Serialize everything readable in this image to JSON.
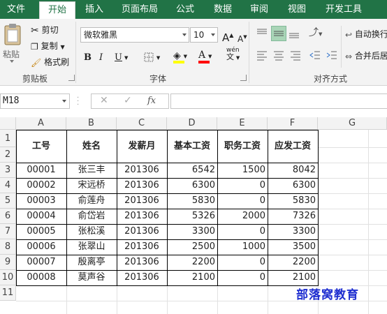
{
  "tabs": [
    {
      "id": "file",
      "label": "文件"
    },
    {
      "id": "home",
      "label": "开始"
    },
    {
      "id": "insert",
      "label": "插入"
    },
    {
      "id": "layout",
      "label": "页面布局"
    },
    {
      "id": "formulas",
      "label": "公式"
    },
    {
      "id": "data",
      "label": "数据"
    },
    {
      "id": "review",
      "label": "审阅"
    },
    {
      "id": "view",
      "label": "视图"
    },
    {
      "id": "developer",
      "label": "开发工具"
    }
  ],
  "clipboard": {
    "paste_label": "粘贴",
    "cut_label": "剪切",
    "copy_label": "复制",
    "painter_label": "格式刷",
    "group_label": "剪贴板"
  },
  "font": {
    "family": "微软雅黑",
    "size": "10",
    "grow_label": "A",
    "shrink_label": "A",
    "bold_label": "B",
    "italic_label": "I",
    "underline_label": "U",
    "fontcolor_label": "A",
    "phonetic_label": "wén",
    "group_label": "字体"
  },
  "alignment": {
    "wrap_label": "自动换行",
    "merge_label": "合并后居",
    "group_label": "对齐方式"
  },
  "formula_bar": {
    "name_box": "M18",
    "fx_label": "fx",
    "formula": ""
  },
  "grid": {
    "columns": [
      "A",
      "B",
      "C",
      "D",
      "E",
      "F",
      "G"
    ],
    "rows": [
      "1",
      "2",
      "3",
      "4",
      "5",
      "6",
      "7",
      "8",
      "9",
      "10",
      "11"
    ],
    "headers": [
      "工号",
      "姓名",
      "发薪月",
      "基本工资",
      "职务工资",
      "应发工资"
    ],
    "records": [
      [
        "00001",
        "张三丰",
        "201306",
        "6542",
        "1500",
        "8042"
      ],
      [
        "00002",
        "宋远桥",
        "201306",
        "6300",
        "0",
        "6300"
      ],
      [
        "00003",
        "俞莲舟",
        "201306",
        "5830",
        "0",
        "5830"
      ],
      [
        "00004",
        "俞岱岩",
        "201306",
        "5326",
        "2000",
        "7326"
      ],
      [
        "00005",
        "张松溪",
        "201306",
        "3300",
        "0",
        "3300"
      ],
      [
        "00006",
        "张翠山",
        "201306",
        "2500",
        "1000",
        "3500"
      ],
      [
        "00007",
        "殷离亭",
        "201306",
        "2200",
        "0",
        "2200"
      ],
      [
        "00008",
        "莫声谷",
        "201306",
        "2100",
        "0",
        "2100"
      ]
    ]
  },
  "watermark": "部落窝教育",
  "colors": {
    "accent": "#217346",
    "watermark": "#1f2fd0",
    "fill_yellow": "#ffff00",
    "font_red": "#ff0000"
  }
}
